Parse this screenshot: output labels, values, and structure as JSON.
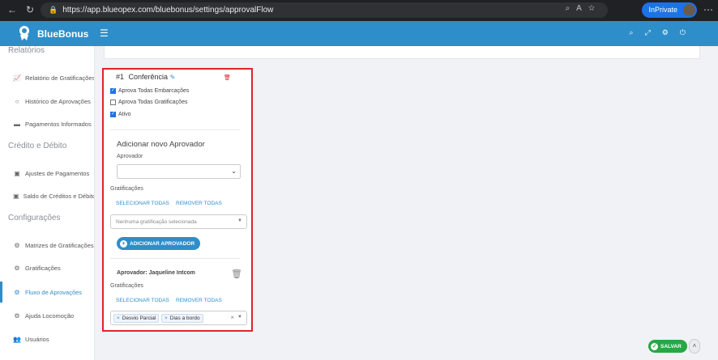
{
  "browser": {
    "url": "https://app.blueopex.com/bluebonus/settings/approvalFlow",
    "profile_label": "InPrivate"
  },
  "app": {
    "name": "BlueBonus",
    "brand_color": "#2e8ec9"
  },
  "sidebar": {
    "section_relatorios": "Relatórios",
    "item_relatorio_gratificacoes": "Relatório de Gratificações",
    "item_historico_aprovacoes": "Histórico de Aprovações",
    "item_pagamentos_informados": "Pagamentos Informados",
    "section_credito_debito": "Crédito e Débito",
    "item_ajustes_pagamentos": "Ajustes de Pagamentos",
    "item_saldo_creditos": "Saldo de Créditos e Débitos",
    "section_configuracoes": "Configurações",
    "item_matrizes": "Matrizes de Gratificações",
    "item_gratificacoes": "Gratificações",
    "item_fluxo_aprovacoes": "Fluxo de Aprovações",
    "item_ajuda_locomocao": "Ajuda Locomoção",
    "item_usuarios": "Usuários"
  },
  "flow": {
    "number": "#1",
    "name": "Conferência",
    "opt_embarcacoes": "Aprova Todas Embarcações",
    "opt_embarcacoes_checked": true,
    "opt_gratificacoes": "Aprova Todas Gratificações",
    "opt_gratificacoes_checked": false,
    "opt_ativo": "Ativo",
    "opt_ativo_checked": true,
    "new_approver_heading": "Adicionar novo Aprovador",
    "approver_label": "Aprovador",
    "approver_value": "",
    "gratificacoes_label": "Gratificações",
    "select_all": "SELECIONAR TODAS",
    "remove_all": "REMOVER TODAS",
    "gratificacoes_placeholder": "Nenhuma gratificação selecionada",
    "add_approver_button": "ADICIONAR APROVADOR",
    "approver_entry_name": "Aprovador: Jaqueline Intcom",
    "entry_gratificacoes_label": "Gratificações",
    "entry_select_all": "SELECIONAR TODAS",
    "entry_remove_all": "REMOVER TODAS",
    "entry_tags": [
      "Desvio Parcial",
      "Dias a bordo"
    ]
  },
  "actions": {
    "save_label": "SALVAR"
  }
}
